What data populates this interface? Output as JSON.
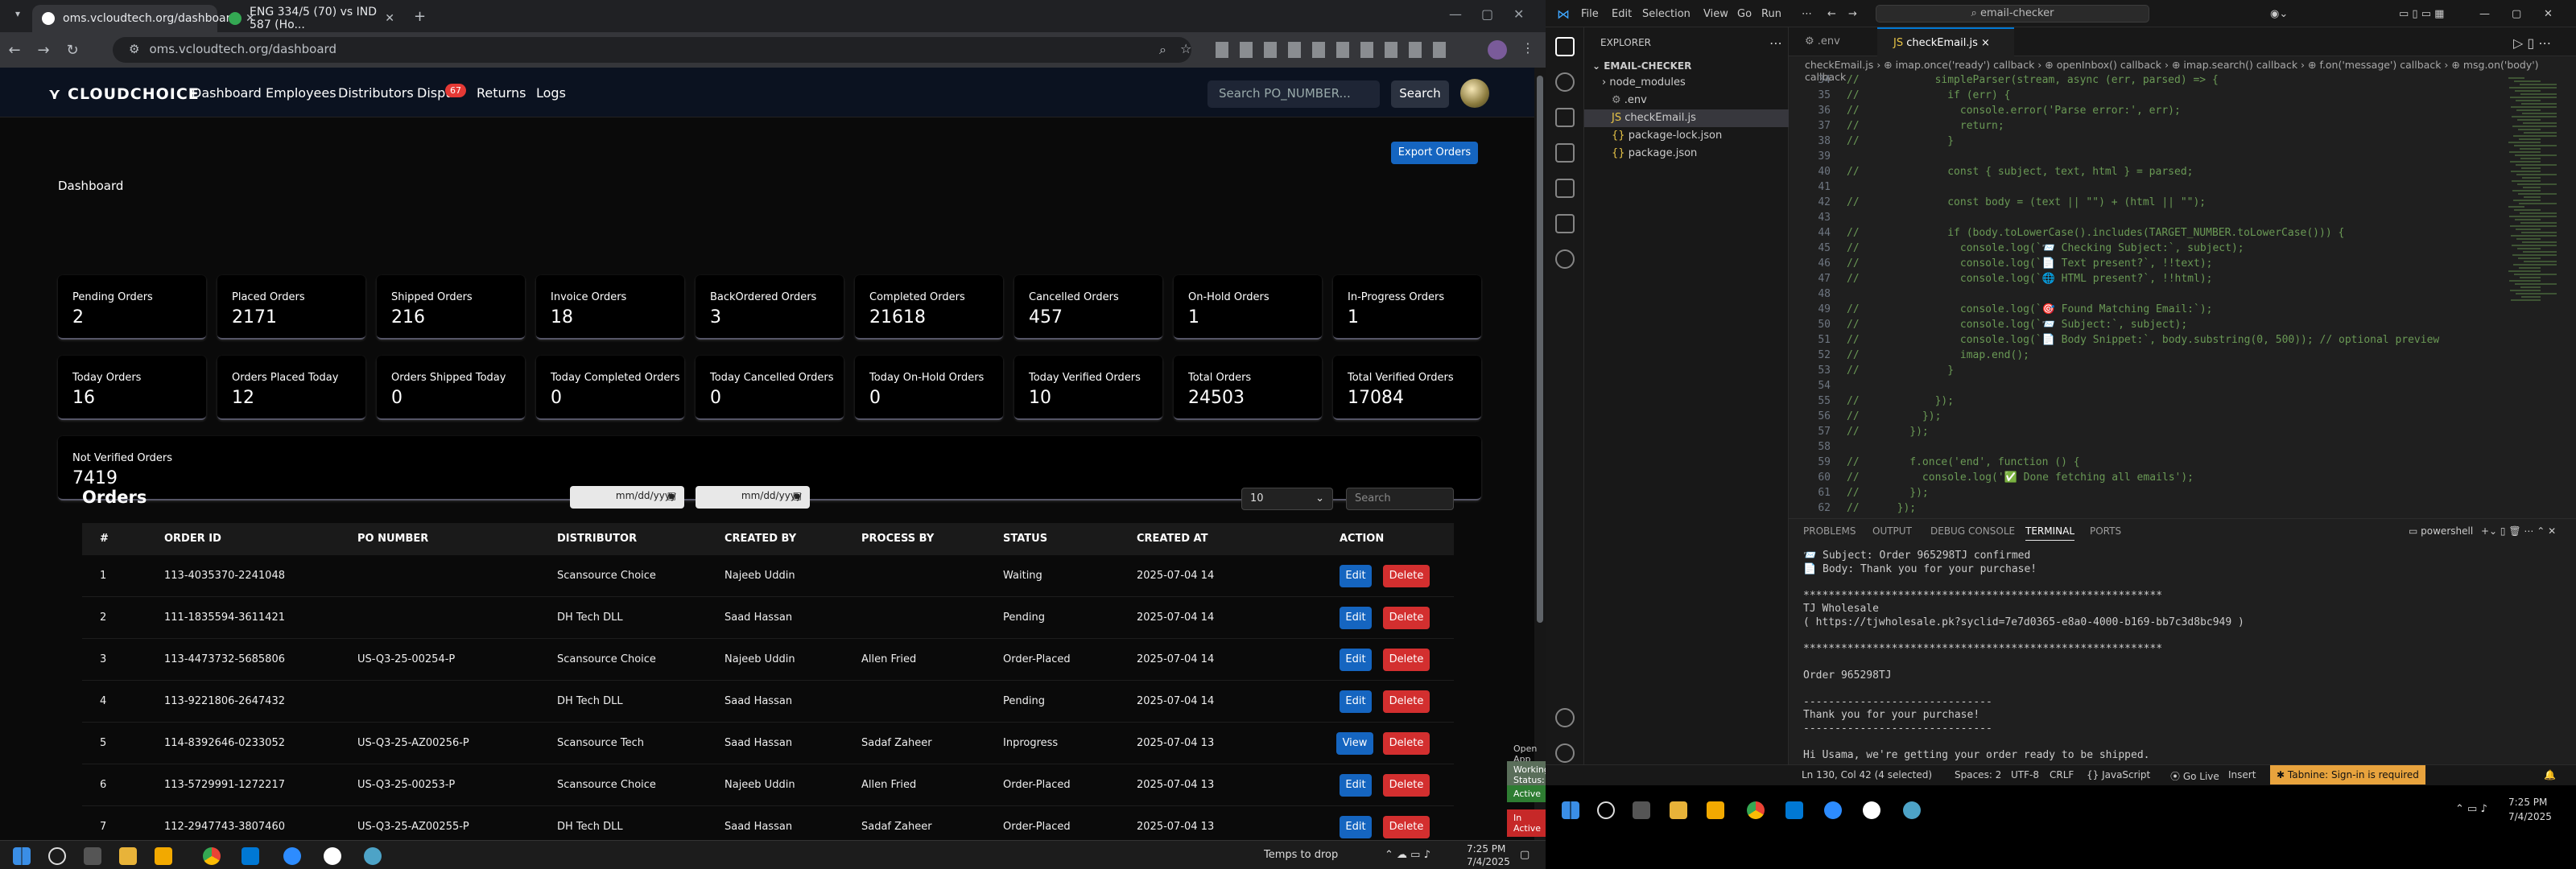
{
  "chrome": {
    "tabs": [
      {
        "label": "oms.vcloudtech.org/dashboard"
      },
      {
        "label": "ENG 334/5 (70) vs IND 587 (Ho..."
      }
    ],
    "new_tab": "+",
    "url": "oms.vcloudtech.org/dashboard"
  },
  "site": {
    "logo": "CLOUDCHOICE",
    "nav": [
      "Dashboard",
      "Employees",
      "Distributors",
      "Dispu",
      "Returns",
      "Logs"
    ],
    "disputes_badge": "67",
    "search_placeholder": "Search PO_NUMBER...",
    "search_btn": "Search",
    "export_btn": "Export Orders",
    "dashboard_title": "Dashboard",
    "cards": [
      {
        "label": "Pending Orders",
        "value": "2"
      },
      {
        "label": "Placed Orders",
        "value": "2171"
      },
      {
        "label": "Shipped Orders",
        "value": "216"
      },
      {
        "label": "Invoice Orders",
        "value": "18"
      },
      {
        "label": "BackOrdered Orders",
        "value": "3"
      },
      {
        "label": "Completed Orders",
        "value": "21618"
      },
      {
        "label": "Cancelled Orders",
        "value": "457"
      },
      {
        "label": "On-Hold Orders",
        "value": "1"
      },
      {
        "label": "In-Progress Orders",
        "value": "1"
      },
      {
        "label": "Today Orders",
        "value": "16"
      },
      {
        "label": "Orders Placed Today",
        "value": "12"
      },
      {
        "label": "Orders Shipped Today",
        "value": "0"
      },
      {
        "label": "Today Completed Orders",
        "value": "0"
      },
      {
        "label": "Today Cancelled Orders",
        "value": "0"
      },
      {
        "label": "Today On-Hold Orders",
        "value": "0"
      },
      {
        "label": "Today Verified Orders",
        "value": "10"
      },
      {
        "label": "Total Orders",
        "value": "24503"
      },
      {
        "label": "Total Verified Orders",
        "value": "17084"
      },
      {
        "label": "Not Verified Orders",
        "value": "7419"
      }
    ],
    "orders_title": "Orders",
    "date_placeholder": "mm/dd/yyyy",
    "page_size": "10",
    "table_search": "Search",
    "columns": [
      "#",
      "ORDER ID",
      "PO NUMBER",
      "DISTRIBUTOR",
      "CREATED BY",
      "PROCESS BY",
      "STATUS",
      "CREATED AT",
      "ACTION"
    ],
    "rows": [
      {
        "n": "1",
        "id": "113-4035370-2241048",
        "po": "",
        "dist": "Scansource Choice",
        "by": "Najeeb Uddin",
        "proc": "",
        "status": "Waiting",
        "at": "2025-07-04 14",
        "btn": "Edit"
      },
      {
        "n": "2",
        "id": "111-1835594-3611421",
        "po": "",
        "dist": "DH Tech DLL",
        "by": "Saad Hassan",
        "proc": "",
        "status": "Pending",
        "at": "2025-07-04 14",
        "btn": "Edit"
      },
      {
        "n": "3",
        "id": "113-4473732-5685806",
        "po": "US-Q3-25-00254-P",
        "dist": "Scansource Choice",
        "by": "Najeeb Uddin",
        "proc": "Allen Fried",
        "status": "Order-Placed",
        "at": "2025-07-04 14",
        "btn": "Edit"
      },
      {
        "n": "4",
        "id": "113-9221806-2647432",
        "po": "",
        "dist": "DH Tech DLL",
        "by": "Saad Hassan",
        "proc": "",
        "status": "Pending",
        "at": "2025-07-04 14",
        "btn": "Edit"
      },
      {
        "n": "5",
        "id": "114-8392646-0233052",
        "po": "US-Q3-25-AZ00256-P",
        "dist": "Scansource Tech",
        "by": "Saad Hassan",
        "proc": "Sadaf Zaheer",
        "status": "Inprogress",
        "at": "2025-07-04 13",
        "btn": "View"
      },
      {
        "n": "6",
        "id": "113-5729991-1272217",
        "po": "US-Q3-25-00253-P",
        "dist": "Scansource Choice",
        "by": "Najeeb Uddin",
        "proc": "Allen Fried",
        "status": "Order-Placed",
        "at": "2025-07-04 13",
        "btn": "Edit"
      },
      {
        "n": "7",
        "id": "112-2947743-3807460",
        "po": "US-Q3-25-AZ00255-P",
        "dist": "DH Tech DLL",
        "by": "Saad Hassan",
        "proc": "Sadaf Zaheer",
        "status": "Order-Placed",
        "at": "2025-07-04 13",
        "btn": "Edit"
      }
    ],
    "delete_label": "Delete"
  },
  "taskbar_left": {
    "drop": "Temps to drop",
    "time": "7:25 PM",
    "date": "7/4/2025",
    "toasts": [
      "Working Status: Active",
      "Active",
      "In Active",
      "Open App"
    ]
  },
  "vscode": {
    "menu": [
      "File",
      "Edit",
      "Selection",
      "View",
      "Go",
      "Run"
    ],
    "command": "email-checker",
    "explorer_title": "EXPLORER",
    "folder": "EMAIL-CHECKER",
    "files": [
      "node_modules",
      ".env",
      "checkEmail.js",
      "package-lock.json",
      "package.json"
    ],
    "tabs": [
      ".env",
      "checkEmail.js"
    ],
    "tab_close": "×",
    "breadcrumb": "checkEmail.js › ⊕ imap.once('ready') callback › ⊕ openInbox() callback › ⊕ imap.search() callback › ⊕ f.on('message') callback › ⊕ msg.on('body') callback",
    "code": [
      {
        "n": "34",
        "t": "//            simpleParser(stream, async (err, parsed) => {"
      },
      {
        "n": "35",
        "t": "//              if (err) {"
      },
      {
        "n": "36",
        "t": "//                console.error('Parse error:', err);"
      },
      {
        "n": "37",
        "t": "//                return;"
      },
      {
        "n": "38",
        "t": "//              }"
      },
      {
        "n": "39",
        "t": ""
      },
      {
        "n": "40",
        "t": "//              const { subject, text, html } = parsed;"
      },
      {
        "n": "41",
        "t": ""
      },
      {
        "n": "42",
        "t": "//              const body = (text || \"\") + (html || \"\");"
      },
      {
        "n": "43",
        "t": ""
      },
      {
        "n": "44",
        "t": "//              if (body.toLowerCase().includes(TARGET_NUMBER.toLowerCase())) {"
      },
      {
        "n": "45",
        "t": "//                console.log(`📨 Checking Subject:`, subject);"
      },
      {
        "n": "46",
        "t": "//                console.log(`📄 Text present?`, !!text);"
      },
      {
        "n": "47",
        "t": "//                console.log(`🌐 HTML present?`, !!html);"
      },
      {
        "n": "48",
        "t": ""
      },
      {
        "n": "49",
        "t": "//                console.log(`🎯 Found Matching Email:`);"
      },
      {
        "n": "50",
        "t": "//                console.log(`📨 Subject:`, subject);"
      },
      {
        "n": "51",
        "t": "//                console.log(`📄 Body Snippet:`, body.substring(0, 500)); // optional preview"
      },
      {
        "n": "52",
        "t": "//                imap.end();"
      },
      {
        "n": "53",
        "t": "//              }"
      },
      {
        "n": "54",
        "t": ""
      },
      {
        "n": "55",
        "t": "//            });"
      },
      {
        "n": "56",
        "t": "//          });"
      },
      {
        "n": "57",
        "t": "//        });"
      },
      {
        "n": "58",
        "t": ""
      },
      {
        "n": "59",
        "t": "//        f.once('end', function () {"
      },
      {
        "n": "60",
        "t": "//          console.log('✅ Done fetching all emails');"
      },
      {
        "n": "61",
        "t": "//        });"
      },
      {
        "n": "62",
        "t": "//      });"
      }
    ],
    "panel_tabs": [
      "PROBLEMS",
      "OUTPUT",
      "DEBUG CONSOLE",
      "TERMINAL",
      "PORTS"
    ],
    "shell": "powershell",
    "terminal": [
      "📨 Subject: Order 965298TJ confirmed",
      "📄 Body: Thank you for your purchase!",
      "",
      "*********************************************************",
      "TJ Wholesale",
      "( https://tjwholesale.pk?syclid=7e7d0365-e8a0-4000-b169-bb7c3d8bc949 )",
      "",
      "*********************************************************",
      "",
      "Order 965298TJ",
      "",
      "------------------------------",
      "Thank you for your purchase!",
      "------------------------------",
      "",
      "Hi Usama, we're getting your order ready to be shipped."
    ],
    "status": {
      "pos": "Ln 130, Col 42 (4 selected)",
      "spaces": "Spaces: 2",
      "enc": "UTF-8",
      "eol": "CRLF",
      "lang": "{} JavaScript",
      "live": "Go Live",
      "insert": "Insert",
      "tabnine": "Tabnine: Sign-in is required"
    },
    "time": "7:25 PM",
    "date": "7/4/2025"
  },
  "colors": {
    "edit": "#1565c0",
    "delete": "#d32f2f",
    "view": "#1565c0",
    "accent": "#0078d4"
  }
}
